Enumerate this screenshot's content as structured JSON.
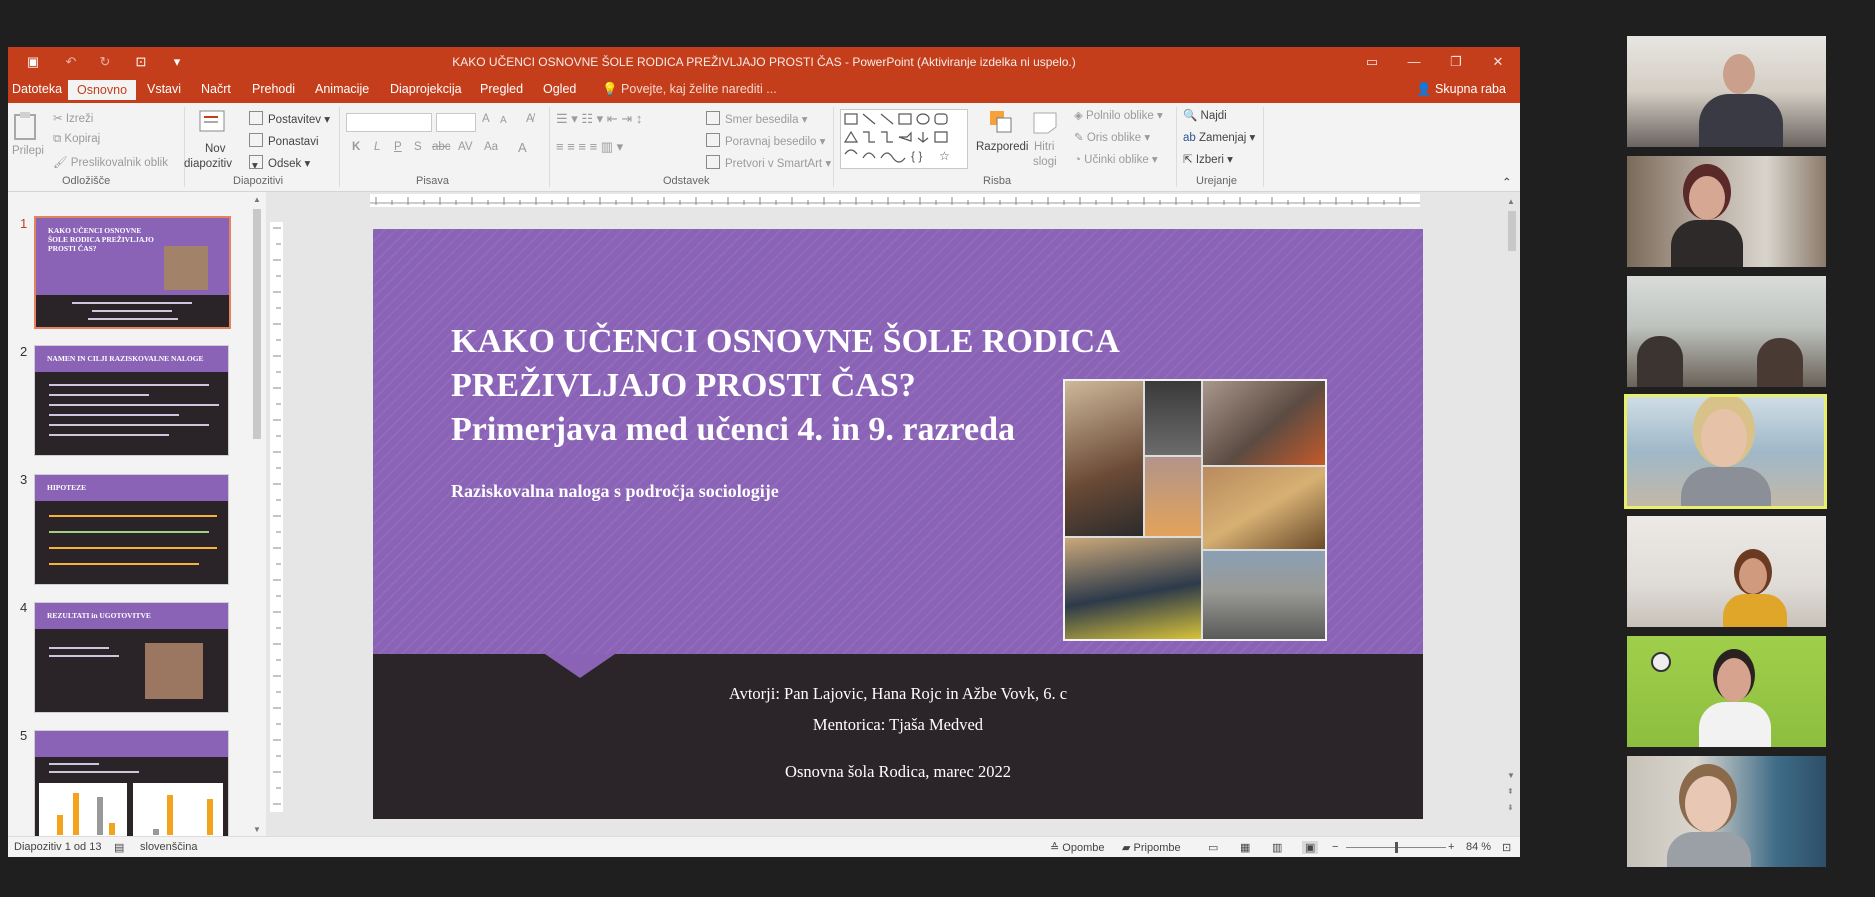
{
  "window": {
    "title": "KAKO UČENCI OSNOVNE ŠOLE RODICA PREŽIVLJAJO PROSTI ČAS - PowerPoint (Aktiviranje izdelka ni uspelo.)"
  },
  "tabs": [
    "Datoteka",
    "Osnovno",
    "Vstavi",
    "Načrt",
    "Prehodi",
    "Animacije",
    "Diaprojekcija",
    "Pregled",
    "Ogled"
  ],
  "tell_me": "Povejte, kaj želite narediti ...",
  "share": "Skupna raba",
  "ribbon": {
    "paste": "Prilepi",
    "cut": "Izreži",
    "copy": "Kopiraj",
    "format_painter": "Preslikovalnik oblik",
    "group_clipboard": "Odložišče",
    "new_slide_1": "Nov",
    "new_slide_2": "diapozitiv",
    "layout": "Postavitev",
    "reset": "Ponastavi",
    "section": "Odsek",
    "group_slides": "Diapozitivi",
    "bold": "K",
    "italic": "L",
    "underline": "P",
    "shadow": "S",
    "strike": "abc",
    "spacing": "AV",
    "case": "Aa",
    "font_color": "A",
    "grow": "A",
    "shrink": "A",
    "group_font": "Pisava",
    "text_direction": "Smer besedila",
    "align_text": "Poravnaj besedilo",
    "smartart": "Pretvori v SmartArt",
    "group_paragraph": "Odstavek",
    "arrange": "Razporedi",
    "quick_styles_1": "Hitri",
    "quick_styles_2": "slogi",
    "shape_fill": "Polnilo oblike",
    "shape_outline": "Oris oblike",
    "shape_effects": "Učinki oblike",
    "group_drawing": "Risba",
    "find": "Najdi",
    "replace": "Zamenjaj",
    "select": "Izberi",
    "group_editing": "Urejanje"
  },
  "thumbnails": [
    {
      "num": "1",
      "title": "KAKO UČENCI OSNOVNE ŠOLE RODICA PREŽIVLJAJO PROSTI ČAS?"
    },
    {
      "num": "2",
      "title": "NAMEN IN CILJI RAZISKOVALNE NALOGE"
    },
    {
      "num": "3",
      "title": "HIPOTEZE"
    },
    {
      "num": "4",
      "title": "REZULTATI in UGOTOVITVE"
    },
    {
      "num": "5",
      "title": ""
    }
  ],
  "slide": {
    "title_line1": "KAKO UČENCI OSNOVNE ŠOLE RODICA",
    "title_line2": "PREŽIVLJAJO PROSTI ČAS?",
    "title_line3": "Primerjava med učenci 4. in 9. razreda",
    "subtitle": "Raziskovalna naloga s področja sociologije",
    "authors": "Avtorji: Pan Lajovic, Hana Rojc in Ažbe Vovk, 6. c",
    "mentor": "Mentorica: Tjaša Medved",
    "school_date": "Osnovna šola Rodica, marec 2022"
  },
  "status": {
    "slide_of": "Diapozitiv 1 od 13",
    "language": "slovenščina",
    "notes": "Opombe",
    "comments": "Pripombe",
    "zoom": "84 %",
    "zoom_level": 0.49
  },
  "colors": {
    "accent": "#c43e1c",
    "slide_purple": "#8a63b7",
    "slide_dark": "#2b2529",
    "active_speaker": "#e8ef6a"
  }
}
